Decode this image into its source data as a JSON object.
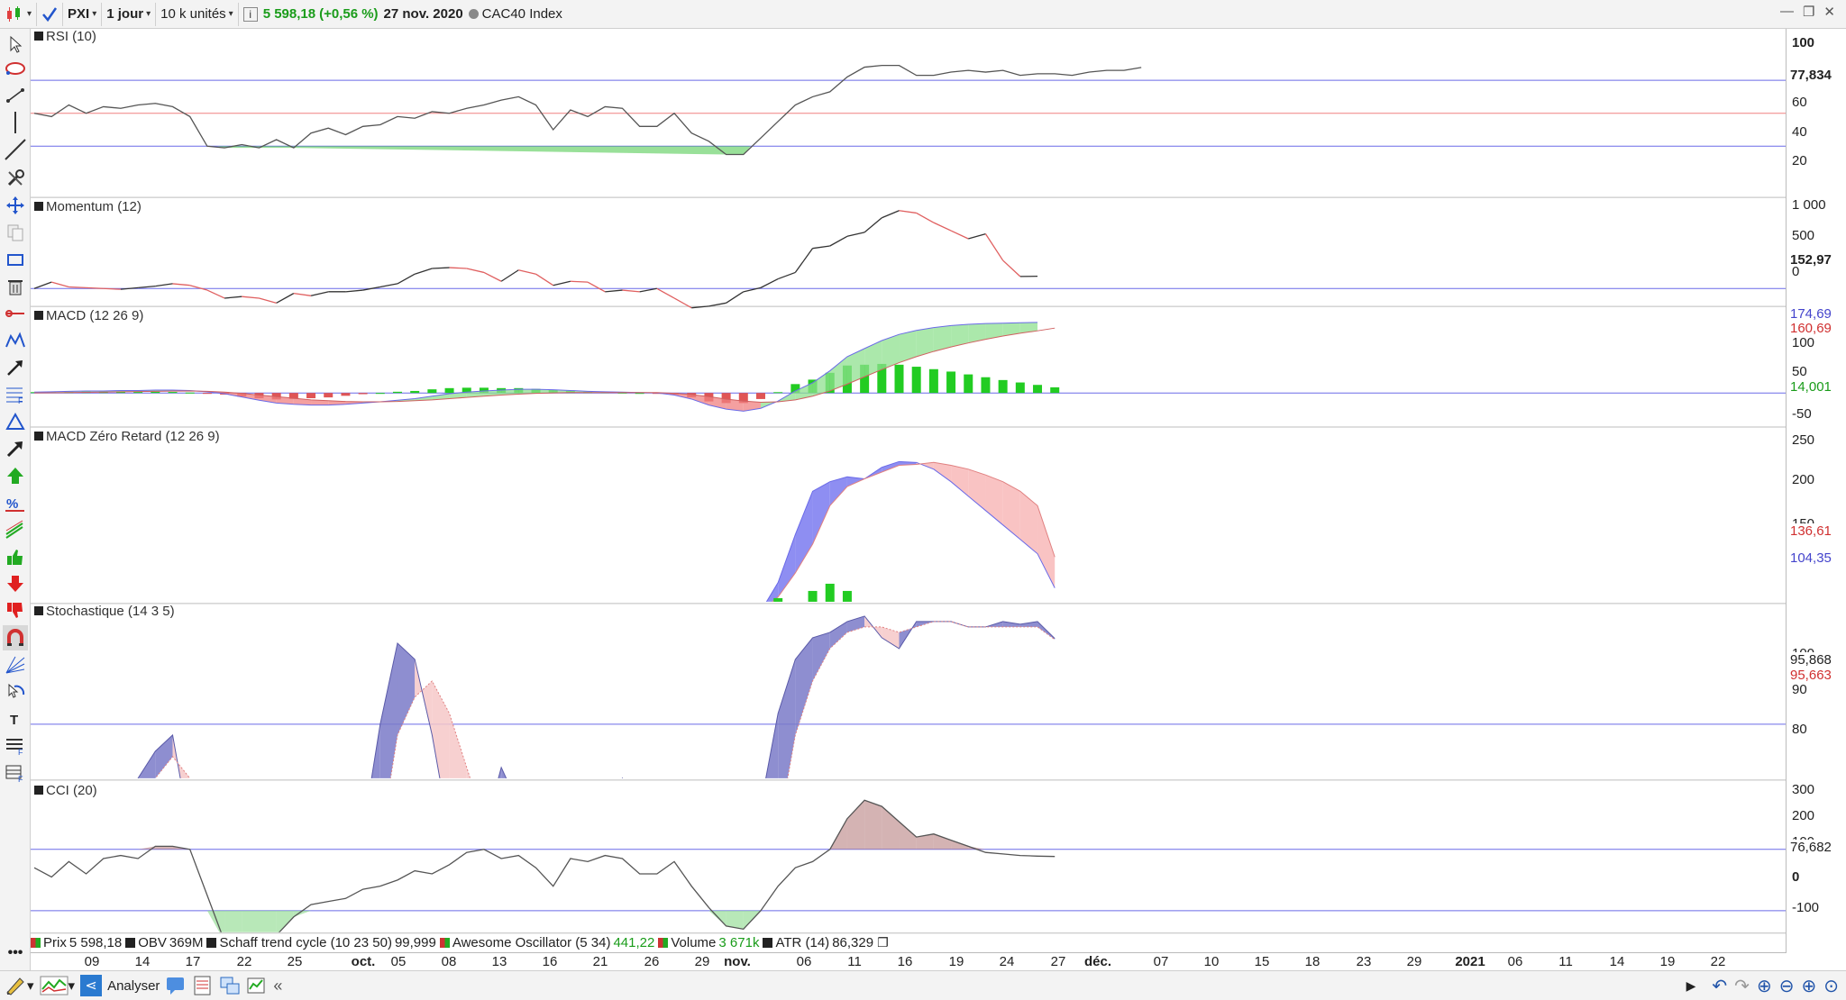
{
  "toolbar": {
    "symbol": "PXI",
    "period": "1 jour",
    "units": "10 k unités",
    "info": "i",
    "price": "5 598,18",
    "change": "(+0,56 %)",
    "date": "27 nov. 2020",
    "index": "CAC40 Index"
  },
  "colors": {
    "up": "#22cc22",
    "down": "#e05555",
    "blue": "#6a6ae8",
    "pink": "#f4b4b4",
    "line": "#555555"
  },
  "panels": [
    {
      "key": "rsi",
      "label": "RSI (10)",
      "ticks": [
        "100",
        "60",
        "40",
        "20"
      ],
      "last": [
        {
          "text": "77,834",
          "color": "#111111"
        }
      ]
    },
    {
      "key": "momentum",
      "label": "Momentum (12)",
      "ticks": [
        "1 000",
        "500",
        "0"
      ],
      "last": [
        {
          "text": "152,97",
          "color": "#111111"
        }
      ]
    },
    {
      "key": "macd",
      "label": "MACD (12 26 9)",
      "ticks": [
        "100",
        "50",
        "-50"
      ],
      "last": [
        {
          "text": "174,69",
          "color": "#4444cc"
        },
        {
          "text": "160,69",
          "color": "#d03030"
        },
        {
          "text": "14,001",
          "color": "#1a9c1a"
        }
      ]
    },
    {
      "key": "macdzr",
      "label": "MACD Zéro Retard (12 26 9)",
      "ticks": [
        "250",
        "200",
        "150"
      ],
      "last": [
        {
          "text": "136,61",
          "color": "#d03030"
        },
        {
          "text": "104,35",
          "color": "#4444cc"
        }
      ]
    },
    {
      "key": "stoch",
      "label": "Stochastique (14 3 5)",
      "ticks": [
        "100",
        "90",
        "80"
      ],
      "last": [
        {
          "text": "95,868",
          "color": "#111111"
        },
        {
          "text": "95,663",
          "color": "#d03030"
        }
      ]
    },
    {
      "key": "cci",
      "label": "CCI (20)",
      "ticks": [
        "300",
        "200",
        "100",
        "0",
        "-100"
      ],
      "last": [
        {
          "text": "76,682",
          "color": "#111111"
        }
      ]
    }
  ],
  "legend": [
    {
      "name": "Prix",
      "value": "5 598,18",
      "color": "#cc3333",
      "valcolor": "#222222"
    },
    {
      "name": "OBV",
      "value": "369M",
      "color": "#222222",
      "valcolor": "#222222"
    },
    {
      "name": "Schaff trend cycle (10 23 50)",
      "value": "99,999",
      "color": "#222222",
      "valcolor": "#222222"
    },
    {
      "name": "Awesome Oscillator (5 34)",
      "value": "441,22",
      "color": "#cc3333",
      "valcolor": "#1a9c1a"
    },
    {
      "name": "Volume",
      "value": "3 671k",
      "color": "#cc3333",
      "valcolor": "#1a9c1a"
    },
    {
      "name": "ATR (14)",
      "value": "86,329",
      "color": "#222222",
      "valcolor": "#222222"
    }
  ],
  "bottom": {
    "analyse": "Analyser"
  },
  "chart_data": [
    {
      "type": "line",
      "title": "RSI (10)",
      "ylim": [
        0,
        100
      ],
      "levels": [
        30,
        50,
        70
      ],
      "x": [
        "09-07",
        "09-08",
        "09-09",
        "09-10",
        "09-11",
        "09-14",
        "09-15",
        "09-16",
        "09-17",
        "09-18",
        "09-21",
        "09-22",
        "09-23",
        "09-24",
        "09-25",
        "09-28",
        "09-29",
        "09-30",
        "10-01",
        "10-02",
        "10-05",
        "10-06",
        "10-07",
        "10-08",
        "10-09",
        "10-12",
        "10-13",
        "10-14",
        "10-15",
        "10-16",
        "10-19",
        "10-20",
        "10-21",
        "10-22",
        "10-23",
        "10-26",
        "10-27",
        "10-28",
        "10-29",
        "10-30",
        "11-02",
        "11-03",
        "11-04",
        "11-05",
        "11-06",
        "11-09",
        "11-10",
        "11-11",
        "11-12",
        "11-13",
        "11-16",
        "11-17",
        "11-18",
        "11-19",
        "11-20",
        "11-23",
        "11-24",
        "11-25",
        "11-26",
        "11-27"
      ],
      "series": [
        {
          "values": [
            50,
            48,
            55,
            50,
            54,
            53,
            55,
            56,
            54,
            48,
            30,
            29,
            31,
            29,
            34,
            29,
            38,
            41,
            37,
            42,
            43,
            48,
            47,
            51,
            50,
            53,
            55,
            58,
            60,
            55,
            40,
            52,
            48,
            54,
            53,
            42,
            42,
            50,
            38,
            33,
            25,
            25,
            35,
            45,
            55,
            60,
            63,
            72,
            78,
            79,
            79,
            73,
            73,
            75,
            76,
            75,
            76,
            73,
            74,
            74,
            73,
            75,
            76,
            76,
            77.8
          ]
        }
      ]
    },
    {
      "type": "line",
      "title": "Momentum (12)",
      "ylim": [
        -200,
        1100
      ],
      "levels": [
        0
      ],
      "x": [
        "09-07",
        "11-27"
      ],
      "series": [
        {
          "values": [
            0,
            80,
            20,
            10,
            0,
            -10,
            10,
            30,
            60,
            40,
            -20,
            -120,
            -100,
            -120,
            -180,
            -60,
            -90,
            -40,
            -40,
            -20,
            20,
            60,
            180,
            250,
            260,
            250,
            200,
            90,
            230,
            180,
            40,
            90,
            80,
            -40,
            -20,
            -40,
            0,
            -120,
            -240,
            -220,
            -180,
            -40,
            10,
            120,
            200,
            500,
            530,
            650,
            700,
            880,
            970,
            940,
            820,
            720,
            620,
            680,
            350,
            150,
            153
          ]
        }
      ]
    },
    {
      "type": "bar",
      "title": "MACD (12 26 9)",
      "ylim": [
        -80,
        210
      ],
      "x": [
        "09-07",
        "11-27"
      ],
      "series": [
        {
          "values": [
            2,
            3,
            4,
            5,
            5,
            6,
            6,
            7,
            7,
            6,
            3,
            -2,
            -10,
            -18,
            -25,
            -28,
            -30,
            -30,
            -28,
            -25,
            -22,
            -18,
            -14,
            -8,
            -2,
            2,
            5,
            7,
            9,
            9,
            8,
            6,
            4,
            3,
            2,
            1,
            0,
            -5,
            -15,
            -30,
            -40,
            -45,
            -38,
            -20,
            5,
            25,
            55,
            90,
            110,
            130,
            145,
            155,
            162,
            167,
            170,
            172,
            173,
            174,
            174.7
          ]
        },
        {
          "values": [
            0,
            0.5,
            1,
            1.5,
            2,
            3,
            3.5,
            4,
            4.5,
            5,
            4,
            2,
            -1,
            -5,
            -9,
            -13,
            -17,
            -19,
            -21,
            -22,
            -22,
            -21,
            -19,
            -17,
            -14,
            -11,
            -8,
            -5,
            -3,
            -1,
            0,
            1,
            1,
            1,
            1,
            1,
            1,
            -1,
            -4,
            -9,
            -15,
            -20,
            -23,
            -22,
            -17,
            -8,
            5,
            22,
            40,
            58,
            75,
            90,
            103,
            114,
            124,
            133,
            141,
            148,
            154,
            160.7
          ]
        },
        {
          "values": [
            2,
            2.5,
            3,
            3.5,
            3,
            3,
            2.5,
            3,
            2.5,
            1,
            -1,
            -4,
            -9,
            -13,
            -16,
            -15,
            -13,
            -11,
            -7,
            -3,
            0,
            3,
            5,
            9,
            12,
            13,
            13,
            12,
            12,
            10,
            8,
            5,
            3,
            2,
            1,
            0,
            -1,
            -4,
            -11,
            -21,
            -25,
            -25,
            -15,
            2,
            22,
            33,
            50,
            68,
            70,
            72,
            70,
            65,
            59,
            53,
            46,
            39,
            32,
            26,
            20,
            14
          ]
        }
      ]
    },
    {
      "type": "line",
      "title": "MACD Zéro Retard (12 26 9)",
      "ylim": [
        90,
        270
      ],
      "x": [
        "11-04",
        "11-27"
      ],
      "series": [
        {
          "values": [
            80,
            110,
            160,
            205,
            215,
            220,
            218,
            230,
            236,
            235,
            228,
            215,
            200,
            185,
            170,
            155,
            140,
            104.35
          ]
        },
        {
          "values": [
            80,
            95,
            120,
            150,
            190,
            210,
            218,
            225,
            232,
            233,
            235,
            232,
            228,
            222,
            215,
            205,
            190,
            136.61
          ]
        }
      ]
    },
    {
      "type": "line",
      "title": "Stochastique (14 3 5)",
      "ylim": [
        70,
        102
      ],
      "levels": [
        80
      ],
      "x": [
        "09-07",
        "11-27"
      ],
      "series": [
        {
          "values": [
            60,
            55,
            50,
            50,
            55,
            60,
            70,
            75,
            78,
            60,
            40,
            30,
            25,
            20,
            30,
            40,
            30,
            20,
            35,
            60,
            80,
            95,
            92,
            78,
            60,
            55,
            60,
            72,
            65,
            50,
            40,
            55,
            50,
            65,
            70,
            60,
            55,
            65,
            50,
            40,
            30,
            40,
            65,
            82,
            92,
            96,
            97,
            99,
            100,
            96,
            94,
            99,
            99,
            99,
            98,
            98,
            99,
            98.5,
            99,
            95.868
          ]
        },
        {
          "values": [
            60,
            58,
            55,
            52,
            53,
            56,
            63,
            70,
            74,
            70,
            55,
            42,
            32,
            26,
            25,
            30,
            33,
            30,
            30,
            40,
            58,
            78,
            85,
            88,
            82,
            72,
            62,
            58,
            60,
            60,
            52,
            48,
            50,
            56,
            62,
            63,
            60,
            62,
            58,
            50,
            42,
            38,
            45,
            60,
            78,
            88,
            94,
            97,
            98,
            98,
            97,
            98,
            99,
            99,
            98,
            98,
            98,
            98,
            98,
            95.663
          ]
        }
      ]
    },
    {
      "type": "area",
      "title": "CCI (20)",
      "ylim": [
        -170,
        320
      ],
      "levels": [
        100,
        -100
      ],
      "x": [
        "09-07",
        "11-27"
      ],
      "series": [
        {
          "values": [
            40,
            10,
            60,
            20,
            70,
            80,
            70,
            110,
            110,
            100,
            -50,
            -200,
            -230,
            -220,
            -180,
            -120,
            -80,
            -70,
            -60,
            -30,
            -20,
            0,
            30,
            20,
            50,
            90,
            100,
            70,
            80,
            40,
            -20,
            70,
            60,
            80,
            70,
            20,
            20,
            60,
            -20,
            -90,
            -150,
            -160,
            -100,
            -20,
            40,
            60,
            100,
            200,
            260,
            240,
            190,
            140,
            150,
            130,
            110,
            90,
            85,
            80,
            78,
            76.7
          ]
        }
      ]
    }
  ],
  "dates": [
    "09",
    "14",
    "17",
    "22",
    "25",
    "oct.",
    "05",
    "08",
    "13",
    "16",
    "21",
    "26",
    "29",
    "nov.",
    "06",
    "11",
    "16",
    "19",
    "24",
    "27",
    "déc.",
    "07",
    "10",
    "15",
    "18",
    "23",
    "29",
    "2021",
    "06",
    "11",
    "14",
    "19",
    "22"
  ]
}
